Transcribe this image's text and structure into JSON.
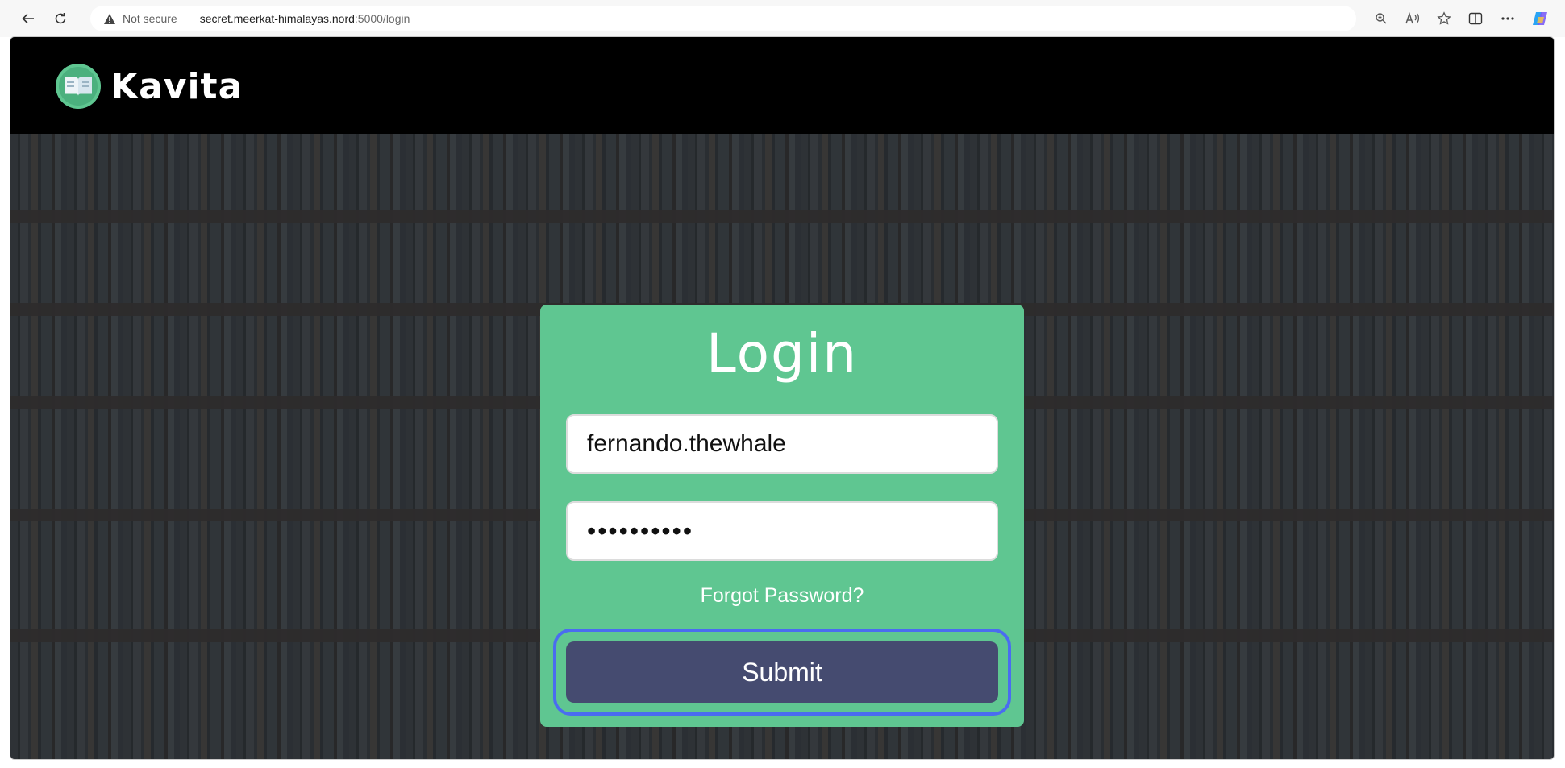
{
  "browser": {
    "security_label": "Not secure",
    "url_host": "secret.meerkat-himalayas.nord",
    "url_rest": ":5000/login",
    "icons": {
      "back": "back-arrow-icon",
      "reload": "reload-icon",
      "warning": "warning-icon",
      "zoom": "zoom-icon",
      "read_aloud": "read-aloud-icon",
      "favorite": "star-icon",
      "split_screen": "split-screen-icon",
      "more": "more-icon",
      "copilot": "copilot-icon"
    }
  },
  "app": {
    "name": "Kavita",
    "logo_icon": "book-logo-icon",
    "header_color": "#000000",
    "accent": "#5fc691"
  },
  "login": {
    "title": "Login",
    "username_value": "fernando.thewhale",
    "password_value": "••••••••••",
    "forgot_label": "Forgot Password?",
    "submit_label": "Submit",
    "submit_color": "#454b70",
    "focus_ring_color": "#4a6cf0"
  }
}
